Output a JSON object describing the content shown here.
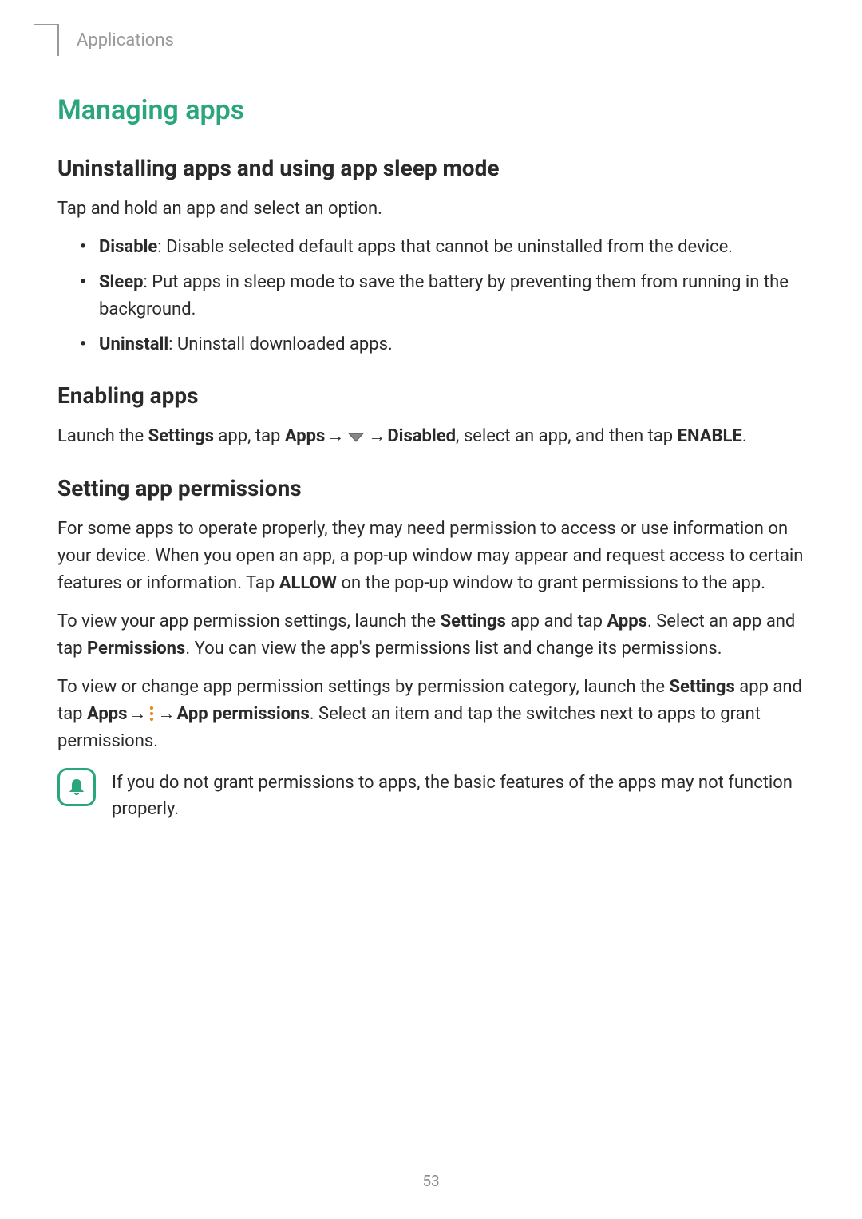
{
  "header": {
    "breadcrumb": "Applications"
  },
  "section": {
    "title": "Managing apps"
  },
  "uninstall": {
    "heading": "Uninstalling apps and using app sleep mode",
    "intro": "Tap and hold an app and select an option.",
    "items": [
      {
        "label": "Disable",
        "desc": ": Disable selected default apps that cannot be uninstalled from the device."
      },
      {
        "label": "Sleep",
        "desc": ": Put apps in sleep mode to save the battery by preventing them from running in the background."
      },
      {
        "label": "Uninstall",
        "desc": ": Uninstall downloaded apps."
      }
    ]
  },
  "enabling": {
    "heading": "Enabling apps",
    "p1_a": "Launch the ",
    "p1_settings": "Settings",
    "p1_b": " app, tap ",
    "p1_apps": "Apps",
    "p1_arrow1": " → ",
    "p1_arrow2": " → ",
    "p1_disabled": "Disabled",
    "p1_c": ", select an app, and then tap ",
    "p1_enable": "ENABLE",
    "p1_d": "."
  },
  "permissions": {
    "heading": "Setting app permissions",
    "p1_a": "For some apps to operate properly, they may need permission to access or use information on your device. When you open an app, a pop-up window may appear and request access to certain features or information. Tap ",
    "p1_allow": "ALLOW",
    "p1_b": " on the pop-up window to grant permissions to the app.",
    "p2_a": "To view your app permission settings, launch the ",
    "p2_settings": "Settings",
    "p2_b": " app and tap ",
    "p2_apps": "Apps",
    "p2_c": ". Select an app and tap ",
    "p2_permissions": "Permissions",
    "p2_d": ". You can view the app's permissions list and change its permissions.",
    "p3_a": "To view or change app permission settings by permission category, launch the ",
    "p3_settings": "Settings",
    "p3_b": " app and tap ",
    "p3_apps": "Apps",
    "p3_arrow1": " → ",
    "p3_arrow2": " → ",
    "p3_appperm": "App permissions",
    "p3_c": ". Select an item and tap the switches next to apps to grant permissions."
  },
  "note": {
    "text": "If you do not grant permissions to apps, the basic features of the apps may not function properly."
  },
  "page_number": "53"
}
